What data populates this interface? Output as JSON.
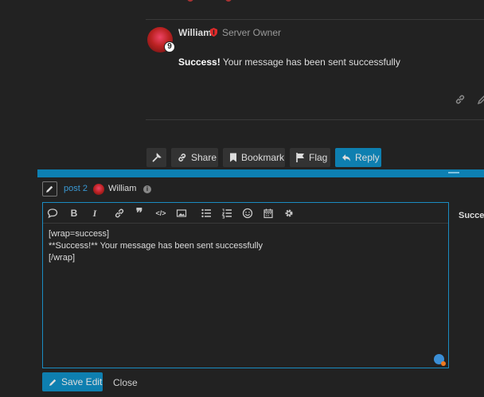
{
  "post": {
    "username": "William",
    "user_title": "Server Owner",
    "flair_glyph": "9",
    "body_bold": "Success!",
    "body_rest": " Your message has been sent successfully"
  },
  "actions": {
    "share": "Share",
    "bookmark": "Bookmark",
    "flag": "Flag",
    "reply": "Reply"
  },
  "composer": {
    "reply_to_post": "post 2",
    "reply_to_user": "William",
    "editor_text": "[wrap=success]\n**Success!** Your message has been sent successfully\n[/wrap]",
    "preview_label": "Success!",
    "save_label": "Save Edit",
    "close_label": "Close",
    "toolbar_icons": [
      "quote-icon",
      "bold-icon",
      "italic-icon",
      "link-icon",
      "blockquote-icon",
      "code-icon",
      "image-icon",
      "bullet-list-icon",
      "numbered-list-icon",
      "emoji-icon",
      "date-icon",
      "options-gear-icon"
    ]
  },
  "colors": {
    "accent": "#0e7fb0",
    "background": "#222222",
    "link": "#3a98d3"
  }
}
